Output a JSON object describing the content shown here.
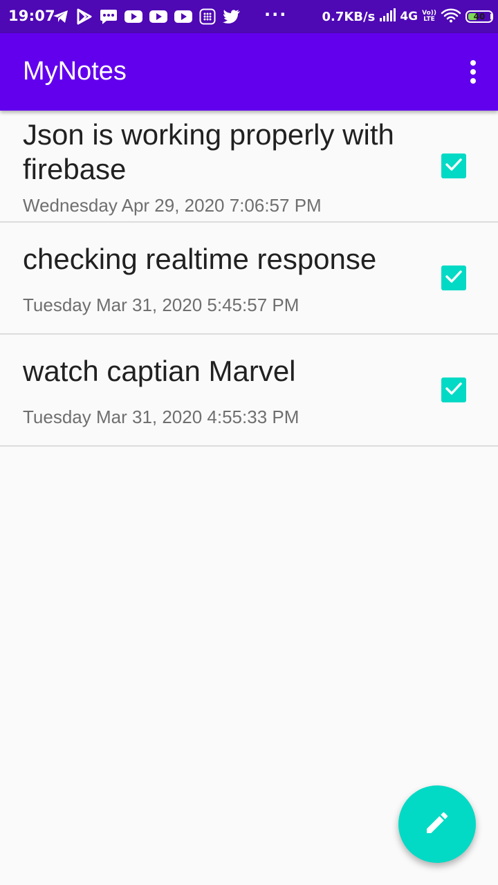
{
  "status_bar": {
    "time": "19:07",
    "more_icons": "···",
    "net_speed": "0.7KB/s",
    "network_type": "4G",
    "volte_top": "Vo))",
    "volte_bottom": "LTE",
    "battery_level": "40",
    "battery_fraction": 0.4,
    "icons": [
      "telegram-icon",
      "play-store-icon",
      "messages-icon",
      "youtube-icon",
      "youtube-icon",
      "youtube-icon",
      "calculator-icon",
      "twitter-icon",
      "signal-icon",
      "wifi-icon",
      "battery-icon"
    ]
  },
  "app_bar": {
    "title": "MyNotes",
    "menu_icon": "more-vert-icon"
  },
  "notes": [
    {
      "title": "Json is working properly with firebase",
      "date": "Wednesday Apr 29, 2020 7:06:57 PM",
      "checked": true
    },
    {
      "title": "checking realtime response",
      "date": "Tuesday Mar 31, 2020 5:45:57 PM",
      "checked": true
    },
    {
      "title": "watch captian Marvel",
      "date": "Tuesday Mar 31, 2020 4:55:33 PM",
      "checked": true
    }
  ],
  "fab": {
    "icon": "edit-pencil-icon"
  },
  "colors": {
    "status_bar": "#4e08b4",
    "app_bar": "#6200ee",
    "accent": "#03dac5",
    "background": "#fafafa",
    "title_text": "#212121",
    "date_text": "#6f6f6f",
    "divider": "#dcdcdc"
  }
}
